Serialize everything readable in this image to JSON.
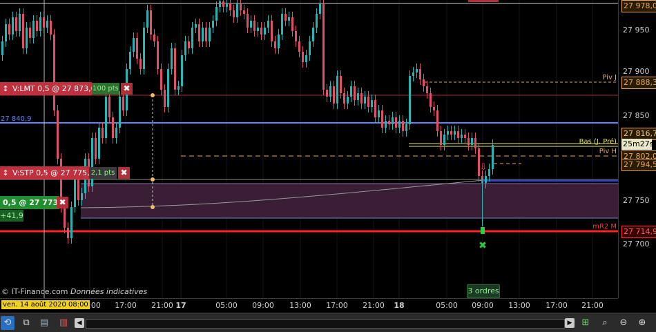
{
  "price_scale": {
    "labels": [
      "27 950",
      "27 900",
      "27 850",
      "27 750",
      "27 700"
    ],
    "tags": {
      "top": "27 978,0",
      "piv_j": "27 888,3",
      "last": "27 816,7",
      "timer": "25m27s",
      "piv_h": "27 802,0",
      "bas_line": "27 794,5",
      "mr2": "27 714,9"
    }
  },
  "chart_labels": {
    "piv_j": "Piv J",
    "piv_h": "Piv H",
    "bas": "Bas (J. Pré)",
    "mr2": "mR2 M",
    "blue_level": "27 840,9",
    "copyright": "© IT-Finance.com",
    "disclaimer": "Données indicatives",
    "orders_button": "3 ordres"
  },
  "orders": {
    "limit": {
      "label": "V:LMT 0,5 @ 27 873,0",
      "pts": "100 pts"
    },
    "stop": {
      "label": "V:STP 0,5 @ 27 775,1",
      "pts": "2,1 pts"
    },
    "position": {
      "label": "0,5 @ 27 773,0",
      "pnl": "+41,9"
    }
  },
  "time_axis": {
    "current_date": "ven. 14 août 2020 08:00",
    "ticks": [
      "08:00",
      "17:00",
      "21:00",
      "17",
      "05:00",
      "09:00",
      "13:00",
      "17:00",
      "21:00",
      "18",
      "05:00",
      "09:00",
      "13:00",
      "17:00",
      "21:00"
    ]
  },
  "colors": {
    "bull": "#26b6b6",
    "bear": "#e0506a",
    "blue_level": "#4a7fff",
    "pivot": "#e8a85c",
    "mr2": "#ff2222",
    "band_fill": "#3c2038"
  },
  "toolbar": {
    "icons": [
      "share-icon",
      "sync-icon",
      "template-icon",
      "indicators-icon",
      "scroll-left-icon",
      "scroll-right-icon",
      "fit-icon",
      "zoom-area-icon",
      "zoom-out-icon",
      "zoom-in-icon"
    ]
  }
}
